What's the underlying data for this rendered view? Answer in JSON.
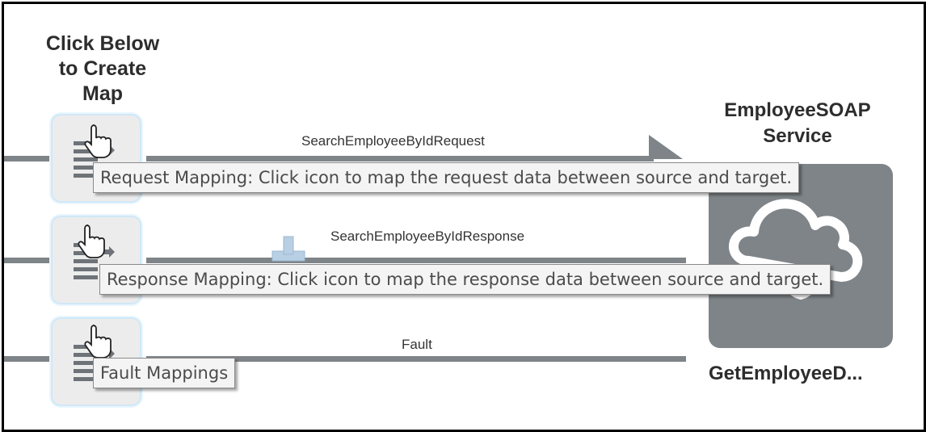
{
  "header": {
    "line1": "Click Below",
    "line2": "to Create",
    "line3": "Map"
  },
  "service": {
    "title_line1": "EmployeeSOAP",
    "title_line2": "Service",
    "operation_label": "GetEmployeeD...",
    "icon": "cloud-icon",
    "color": "#7e8488"
  },
  "flows": {
    "request": {
      "message": "SearchEmployeeByIdRequest"
    },
    "response": {
      "message": "SearchEmployeeByIdResponse"
    },
    "fault": {
      "message": "Fault"
    }
  },
  "tooltips": {
    "request": "Request Mapping: Click icon to map the request data between source and target.",
    "response": "Response Mapping: Click icon to map the response data between source and target.",
    "fault": "Fault Mappings"
  },
  "icons": {
    "mapper": "map-icon",
    "cursor": "hand-pointer-icon"
  },
  "colors": {
    "line": "#7e8488",
    "tile_bg": "#ececec",
    "tile_border": "#cfe8f8"
  }
}
